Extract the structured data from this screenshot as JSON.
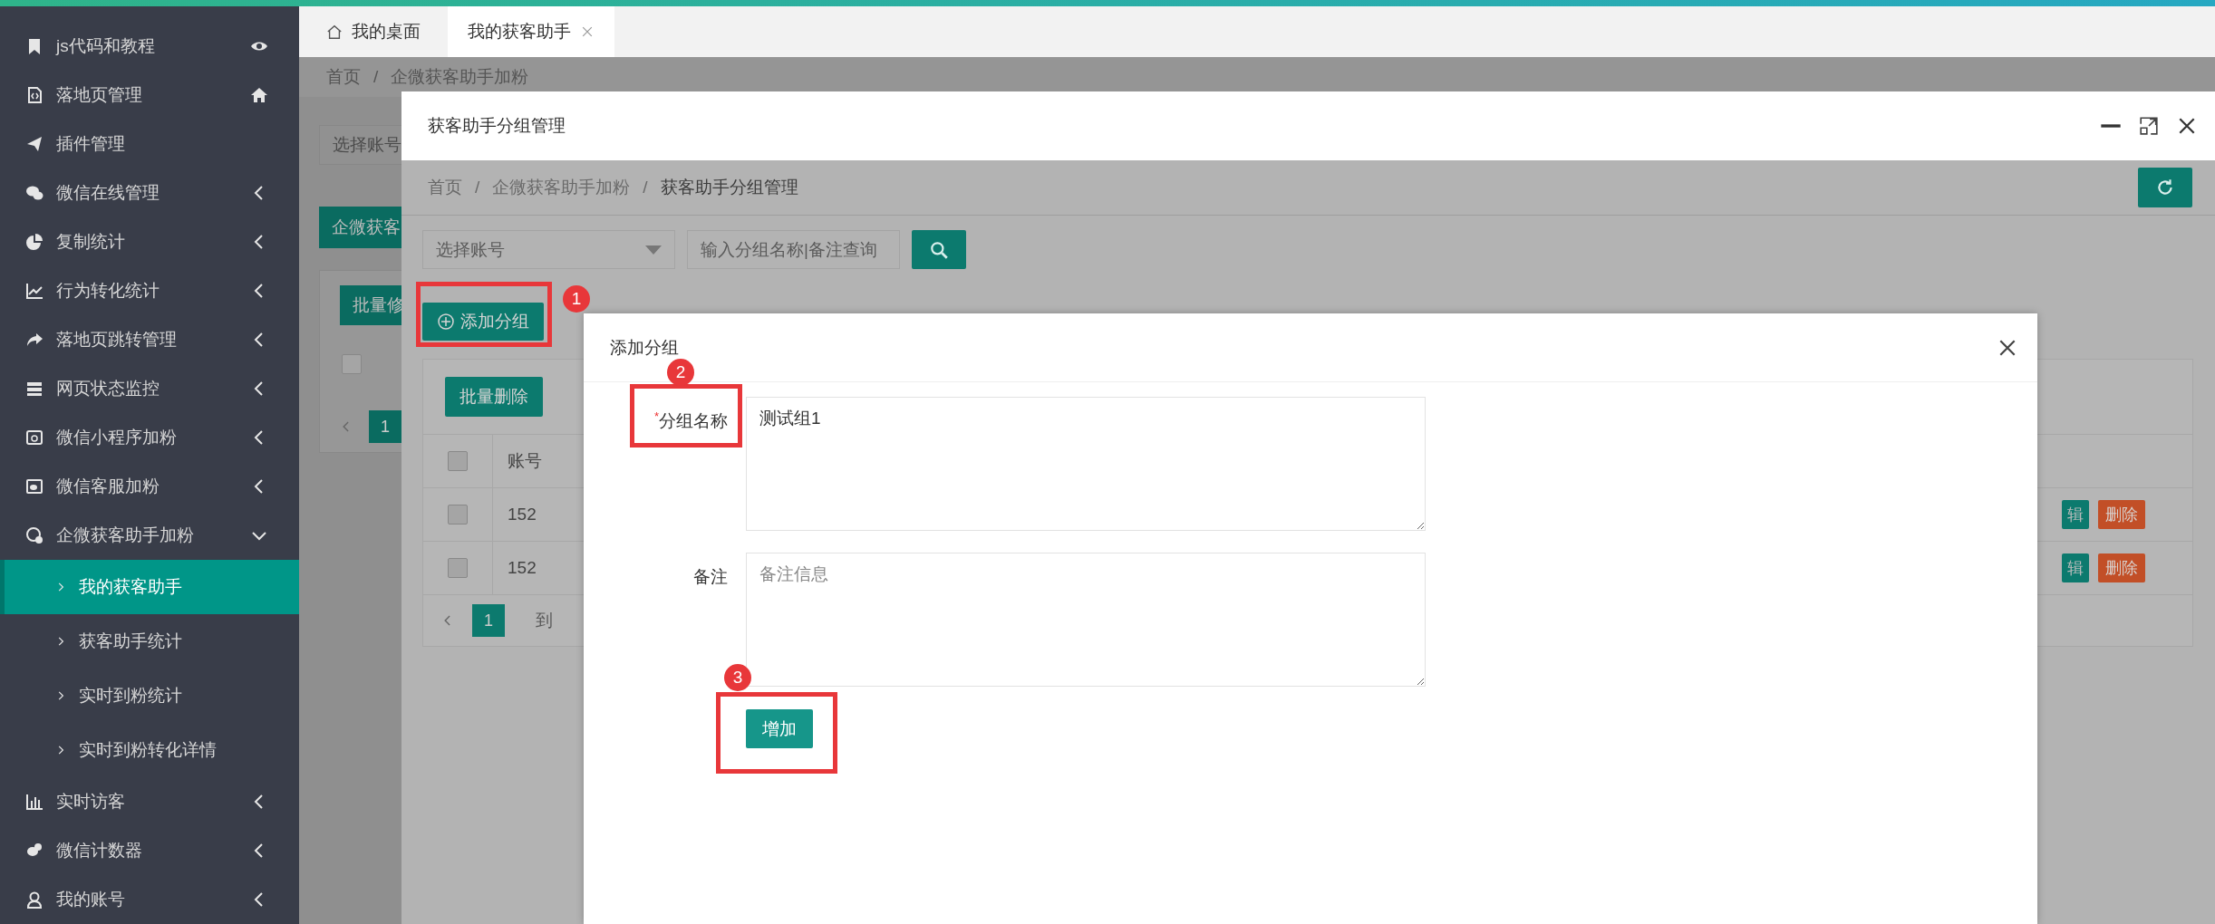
{
  "sidebar": {
    "items": [
      {
        "label": "js代码和教程",
        "kind": "pinned"
      },
      {
        "label": "落地页管理",
        "kind": "pinned"
      },
      {
        "label": "插件管理",
        "kind": "plain"
      },
      {
        "label": "微信在线管理",
        "kind": "group",
        "expanded": false
      },
      {
        "label": "复制统计",
        "kind": "group",
        "expanded": false
      },
      {
        "label": "行为转化统计",
        "kind": "group",
        "expanded": false
      },
      {
        "label": "落地页跳转管理",
        "kind": "group",
        "expanded": false
      },
      {
        "label": "网页状态监控",
        "kind": "group",
        "expanded": false
      },
      {
        "label": "微信小程序加粉",
        "kind": "group",
        "expanded": false
      },
      {
        "label": "微信客服加粉",
        "kind": "group",
        "expanded": false
      },
      {
        "label": "企微获客助手加粉",
        "kind": "group",
        "expanded": true,
        "children": [
          {
            "label": "我的获客助手",
            "selected": true
          },
          {
            "label": "获客助手统计",
            "selected": false
          },
          {
            "label": "实时到粉统计",
            "selected": false
          },
          {
            "label": "实时到粉转化详情",
            "selected": false
          }
        ]
      },
      {
        "label": "实时访客",
        "kind": "group",
        "expanded": false
      },
      {
        "label": "微信计数器",
        "kind": "group",
        "expanded": false
      },
      {
        "label": "我的账号",
        "kind": "group",
        "expanded": false
      }
    ]
  },
  "tabs": [
    {
      "label": "我的桌面",
      "selected": false,
      "closable": false
    },
    {
      "label": "我的获客助手",
      "selected": true,
      "closable": true
    }
  ],
  "background_page": {
    "breadcrumb": {
      "items": [
        "首页",
        "企微获客助手加粉"
      ],
      "separator": "/"
    },
    "account_select": "选择账号",
    "add_button": "企微获客",
    "batch_button": "批量修",
    "select_all_checked": false,
    "page": "1"
  },
  "outer_dialog": {
    "title": "获客助手分组管理",
    "breadcrumb": {
      "items": [
        "首页",
        "企微获客助手加粉",
        "获客助手分组管理"
      ],
      "separator": "/"
    },
    "account_select": {
      "placeholder": "选择账号"
    },
    "search": {
      "placeholder": "输入分组名称|备注查询"
    },
    "add_button": "添加分组",
    "batch_delete_button": "批量删除",
    "table": {
      "columns": [
        "账号"
      ],
      "select_all_checked": false,
      "rows": [
        {
          "account": "152",
          "selected": false,
          "edit": "辑",
          "delete": "删除"
        },
        {
          "account": "152",
          "selected": false,
          "edit": "辑",
          "delete": "删除"
        }
      ]
    },
    "pagination": {
      "page": "1",
      "goto_label": "到"
    }
  },
  "inner_dialog": {
    "title": "添加分组",
    "fields": [
      {
        "label": "分组名称",
        "required_mark": "*",
        "value": "测试组1"
      },
      {
        "label": "备注",
        "placeholder": "备注信息"
      }
    ],
    "submit_button": "增加"
  },
  "annotations": [
    {
      "number": "1"
    },
    {
      "number": "2"
    },
    {
      "number": "3"
    }
  ]
}
